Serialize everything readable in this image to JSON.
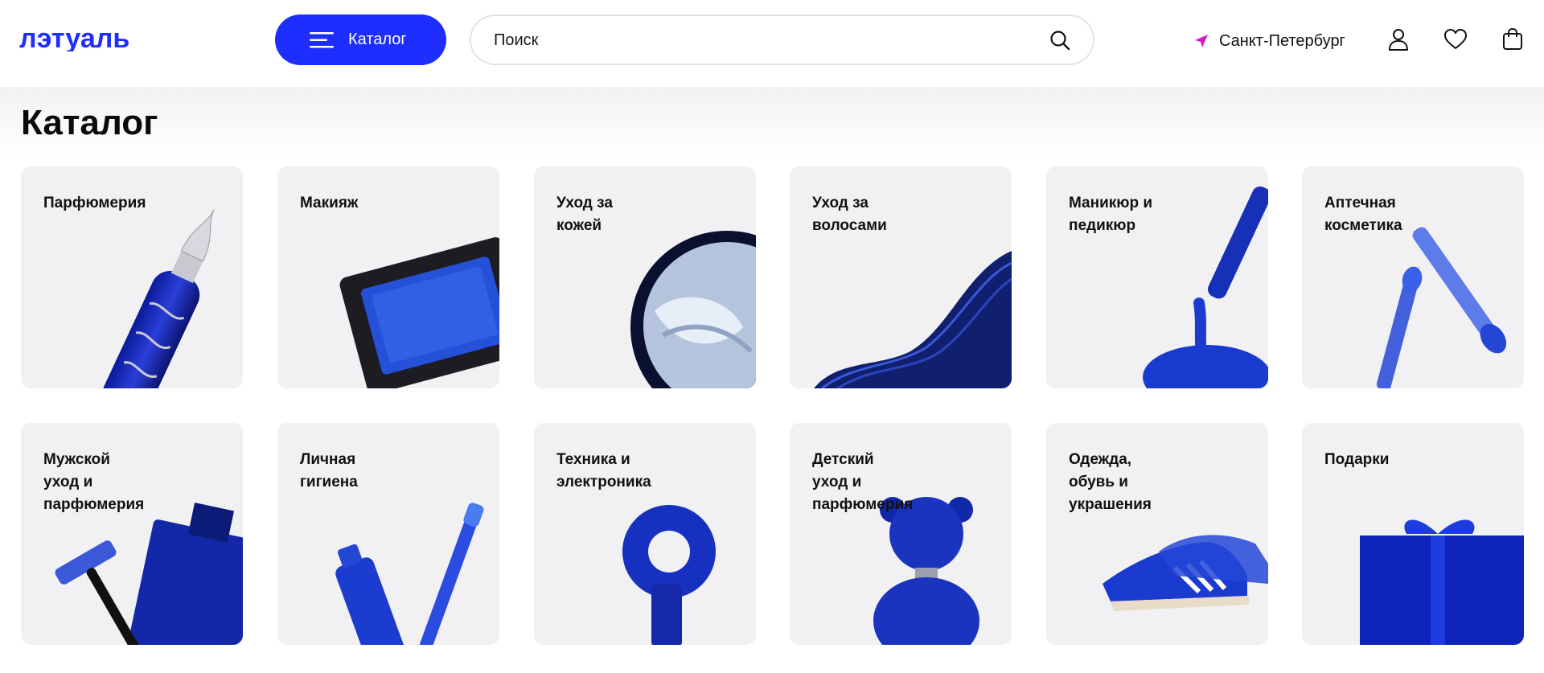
{
  "header": {
    "logo_text": "лэтуаль",
    "catalog_button": "Каталог",
    "search_placeholder": "Поиск",
    "city": "Санкт-Петербург",
    "colors": {
      "accent": "#1e2eff",
      "location_marker": "#d41ac4"
    }
  },
  "page": {
    "title": "Каталог"
  },
  "categories": [
    {
      "label": "Парфюмерия",
      "icon": "perfume-bottle"
    },
    {
      "label": "Макияж",
      "icon": "eyeshadow-palette"
    },
    {
      "label": "Уход за\nкожей",
      "icon": "cream-jar"
    },
    {
      "label": "Уход за\nволосами",
      "icon": "hair-strand"
    },
    {
      "label": "Маникюр и\nпедикюр",
      "icon": "nail-polish-brush"
    },
    {
      "label": "Аптечная\nкосметика",
      "icon": "serum-pipettes"
    },
    {
      "label": "Мужской\nуход и\nпарфюмерия",
      "icon": "razor-and-cologne"
    },
    {
      "label": "Личная\nгигиена",
      "icon": "toothpaste-and-toothbrush"
    },
    {
      "label": "Техника и\nэлектроника",
      "icon": "hair-dryer"
    },
    {
      "label": "Детский\nуход и\nпарфюмерия",
      "icon": "teddy-bear-bottle"
    },
    {
      "label": "Одежда,\nобувь и\nукрашения",
      "icon": "sneakers"
    },
    {
      "label": "Подарки",
      "icon": "gift-box"
    }
  ]
}
